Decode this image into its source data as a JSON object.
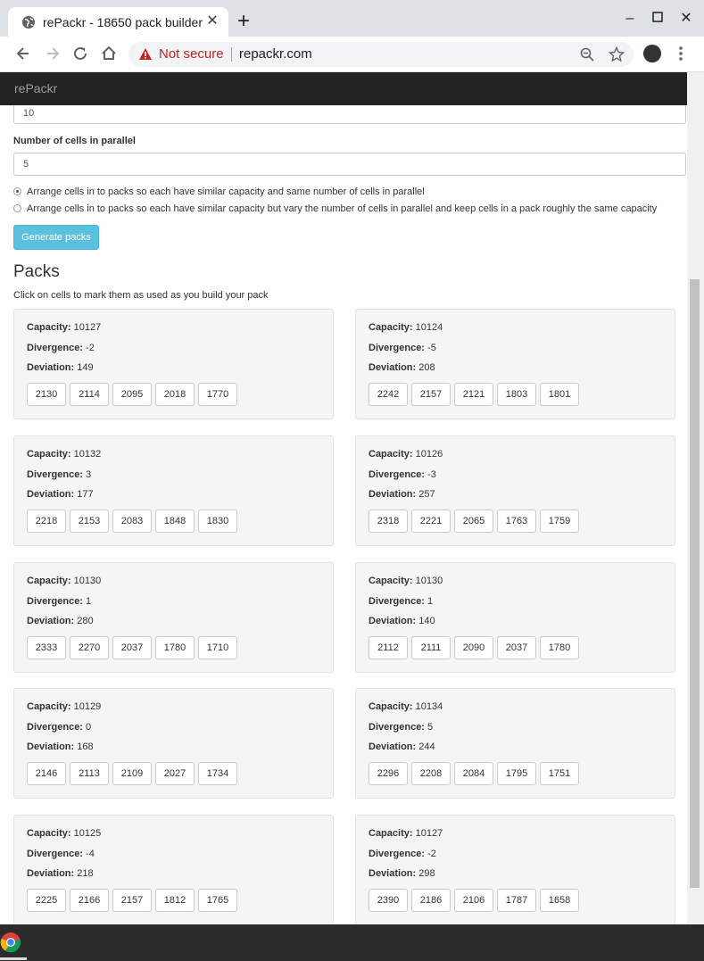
{
  "browser": {
    "tab_title": "rePackr - 18650 pack builder",
    "security_label": "Not secure",
    "url": "repackr.com"
  },
  "navbar": {
    "brand": "rePackr"
  },
  "form": {
    "series_value": "10",
    "parallel_label": "Number of cells in parallel",
    "parallel_value": "5",
    "option_same_parallel": "Arrange cells in to packs so each have similar capacity and same number of cells in parallel",
    "option_vary_parallel": "Arrange cells in to packs so each have similar capacity but vary the number of cells in parallel and keep cells in a pack roughly the same capacity",
    "selected_option": "same_parallel",
    "generate_label": "Generate packs"
  },
  "packs_section": {
    "title": "Packs",
    "subtitle": "Click on cells to mark them as used as you build your pack",
    "capacity_label": "Capacity:",
    "divergence_label": "Divergence:",
    "deviation_label": "Deviation:"
  },
  "packs": [
    {
      "capacity": "10127",
      "divergence": "-2",
      "deviation": "149",
      "cells": [
        "2130",
        "2114",
        "2095",
        "2018",
        "1770"
      ]
    },
    {
      "capacity": "10124",
      "divergence": "-5",
      "deviation": "208",
      "cells": [
        "2242",
        "2157",
        "2121",
        "1803",
        "1801"
      ]
    },
    {
      "capacity": "10132",
      "divergence": "3",
      "deviation": "177",
      "cells": [
        "2218",
        "2153",
        "2083",
        "1848",
        "1830"
      ]
    },
    {
      "capacity": "10126",
      "divergence": "-3",
      "deviation": "257",
      "cells": [
        "2318",
        "2221",
        "2065",
        "1763",
        "1759"
      ]
    },
    {
      "capacity": "10130",
      "divergence": "1",
      "deviation": "280",
      "cells": [
        "2333",
        "2270",
        "2037",
        "1780",
        "1710"
      ]
    },
    {
      "capacity": "10130",
      "divergence": "1",
      "deviation": "140",
      "cells": [
        "2112",
        "2111",
        "2090",
        "2037",
        "1780"
      ]
    },
    {
      "capacity": "10129",
      "divergence": "0",
      "deviation": "168",
      "cells": [
        "2146",
        "2113",
        "2109",
        "2027",
        "1734"
      ]
    },
    {
      "capacity": "10134",
      "divergence": "5",
      "deviation": "244",
      "cells": [
        "2296",
        "2208",
        "2084",
        "1795",
        "1751"
      ]
    },
    {
      "capacity": "10125",
      "divergence": "-4",
      "deviation": "218",
      "cells": [
        "2225",
        "2166",
        "2157",
        "1812",
        "1765"
      ]
    },
    {
      "capacity": "10127",
      "divergence": "-2",
      "deviation": "298",
      "cells": [
        "2390",
        "2186",
        "2106",
        "1787",
        "1658"
      ]
    }
  ],
  "colors": {
    "navbar_bg": "#222222",
    "info_button": "#5bc0de",
    "warning_text": "#c5221f"
  }
}
